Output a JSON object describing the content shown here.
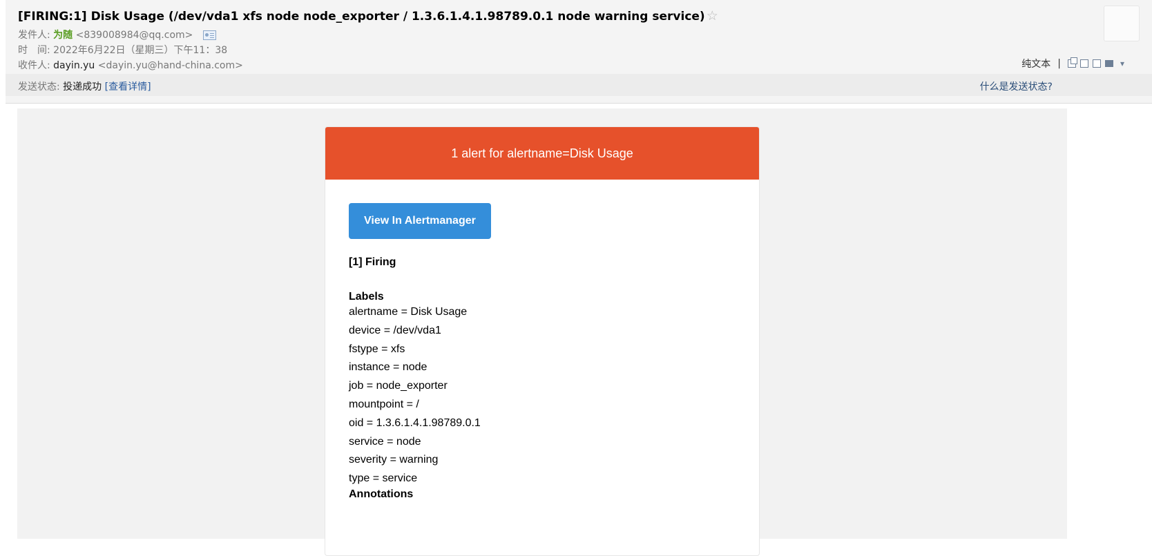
{
  "header": {
    "subject": "[FIRING:1] Disk Usage (/dev/vda1 xfs node node_exporter / 1.3.6.1.4.1.98789.0.1 node warning service)",
    "star": "☆",
    "sender_label": "发件人:",
    "sender_name": "为随",
    "sender_email": "<839008984@qq.com>",
    "time_label": "时　间:",
    "time_value": "2022年6月22日（星期三）下午11：38",
    "recipient_label": "收件人:",
    "recipient_name": "dayin.yu",
    "recipient_email": "<dayin.yu@hand-china.com>"
  },
  "toolbar": {
    "plain_text": "纯文本",
    "separator": "|"
  },
  "status": {
    "label": "发送状态:",
    "value": "投递成功",
    "details_link": "[查看详情]",
    "help_link": "什么是发送状态?"
  },
  "alert": {
    "header_title": "1 alert for alertname=Disk Usage",
    "button_label": "View In Alertmanager",
    "firing_title": "[1] Firing",
    "labels_title": "Labels",
    "labels": [
      "alertname = Disk Usage",
      "device = /dev/vda1",
      "fstype = xfs",
      "instance = node",
      "job = node_exporter",
      "mountpoint = /",
      "oid = 1.3.6.1.4.1.98789.0.1",
      "service = node",
      "severity = warning",
      "type = service"
    ],
    "annotations_title": "Annotations"
  },
  "colors": {
    "alert_header": "#e6512b",
    "button": "#348eda",
    "sender_name": "#5a9e23"
  },
  "icons": [
    "star-icon",
    "contact-card-icon",
    "new-window-icon",
    "full-view-icon",
    "download-icon",
    "print-icon",
    "chevron-down-icon"
  ]
}
